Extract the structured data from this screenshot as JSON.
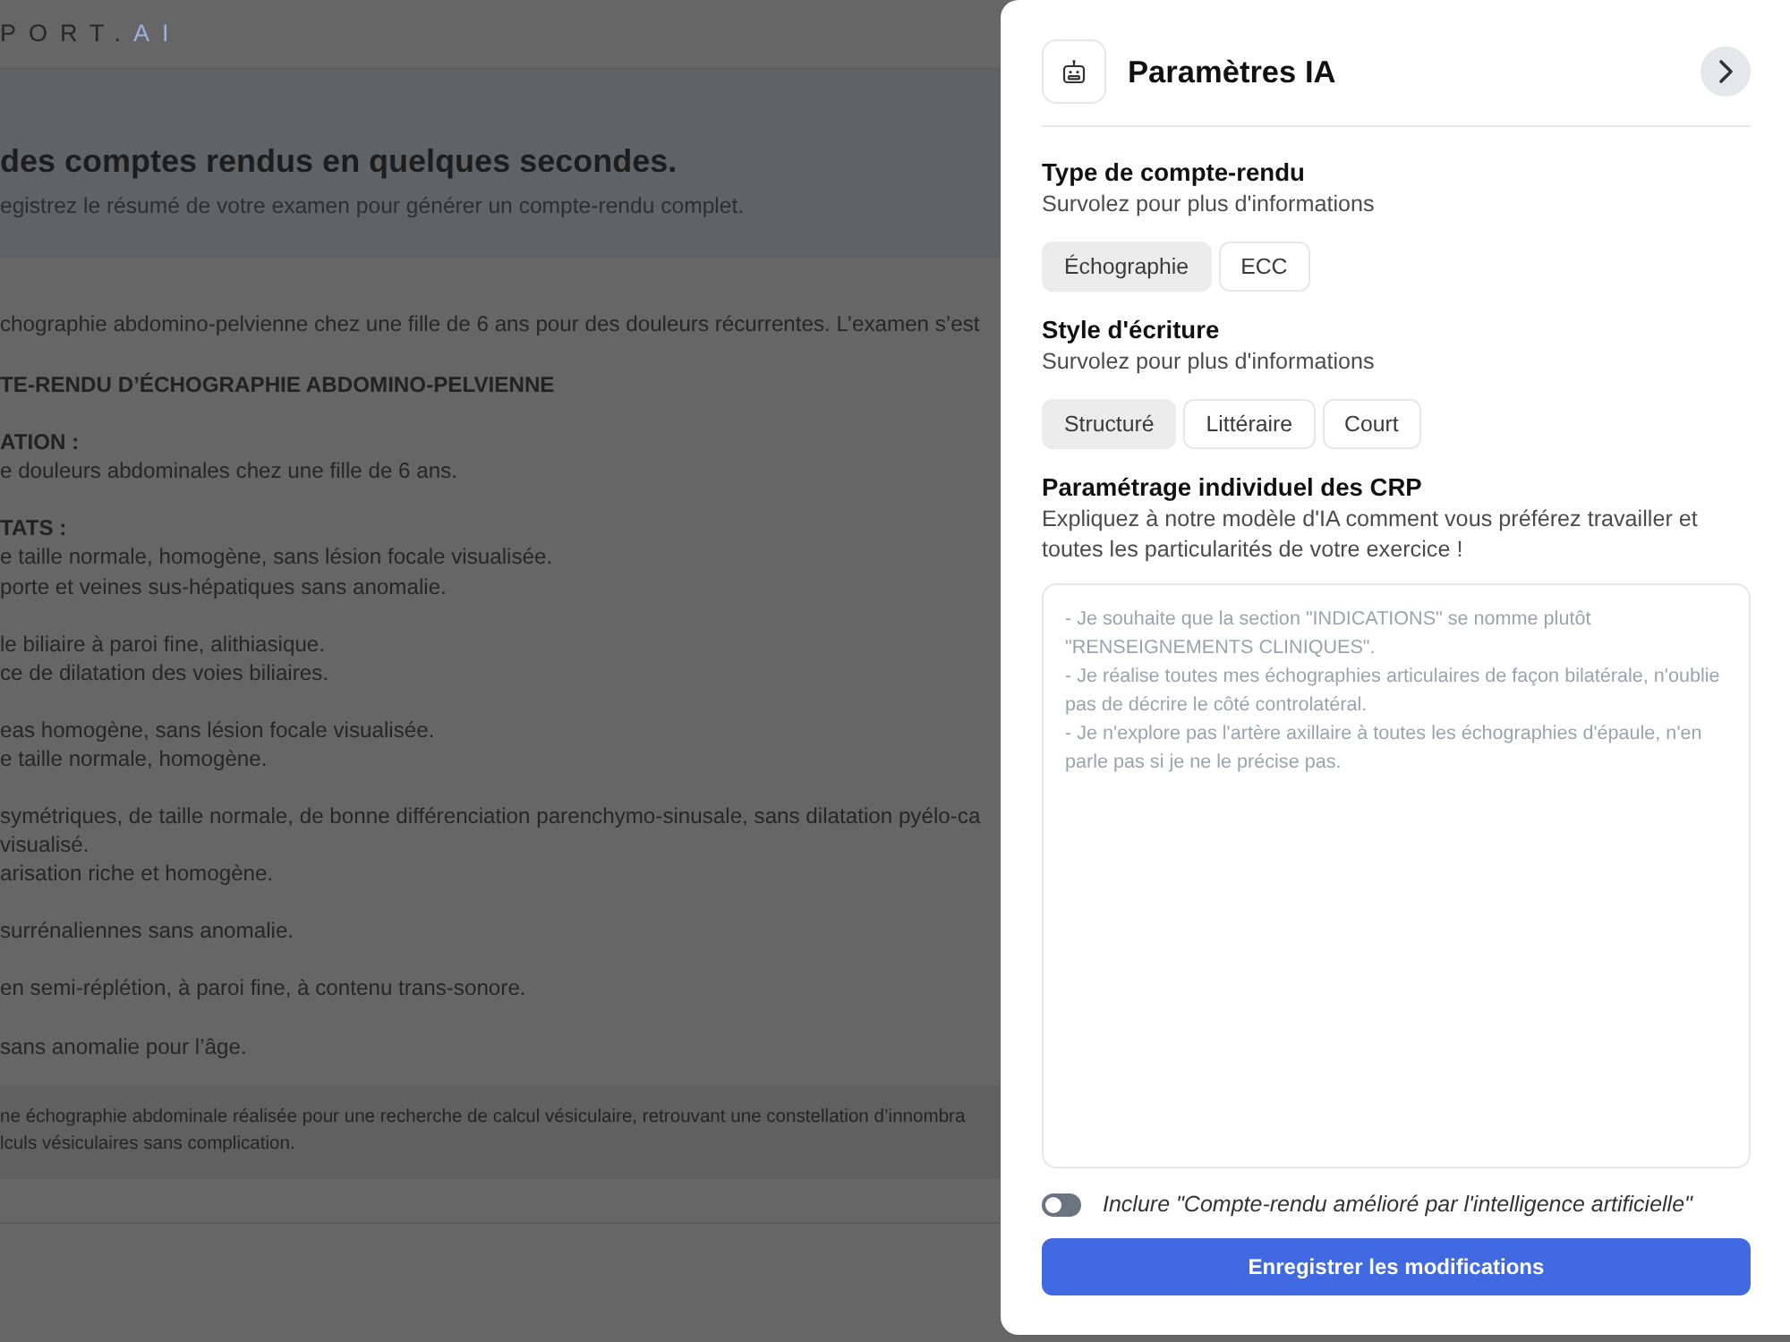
{
  "header": {
    "logo_main": "PORT.",
    "logo_accent": "AI"
  },
  "hero": {
    "title": "des comptes rendus en quelques secondes.",
    "subtitle": "egistrez le résumé de votre examen pour générer un compte-rendu complet."
  },
  "report": {
    "blocks": [
      [
        {
          "kind": "text",
          "text": "chographie abdomino-pelvienne chez une fille de 6 ans pour des douleurs récurrentes. L’examen s’est"
        }
      ],
      [
        {
          "kind": "heading",
          "text": "TE-RENDU D’ÉCHOGRAPHIE ABDOMINO-PELVIENNE"
        }
      ],
      [
        {
          "kind": "heading",
          "text": "ATION :"
        },
        {
          "kind": "text",
          "text": "e douleurs abdominales chez une fille de 6 ans."
        }
      ],
      [
        {
          "kind": "heading",
          "text": "TATS :"
        },
        {
          "kind": "text",
          "text": "e taille normale, homogène, sans lésion focale visualisée."
        },
        {
          "kind": "text",
          "text": "porte et veines sus-hépatiques sans anomalie."
        }
      ],
      [
        {
          "kind": "text",
          "text": "le biliaire à paroi fine, alithiasique."
        },
        {
          "kind": "text",
          "text": "ce de dilatation des voies biliaires."
        }
      ],
      [
        {
          "kind": "text",
          "text": "eas homogène, sans lésion focale visualisée."
        },
        {
          "kind": "text",
          "text": "e taille normale, homogène."
        }
      ],
      [
        {
          "kind": "text",
          "text": "symétriques, de taille normale, de bonne différenciation parenchymo-sinusale, sans dilatation pyélo-ca"
        },
        {
          "kind": "text",
          "text": "visualisé."
        },
        {
          "kind": "text",
          "text": "arisation riche et homogène."
        }
      ],
      [
        {
          "kind": "text",
          "text": "surrénaliennes sans anomalie."
        }
      ],
      [
        {
          "kind": "text",
          "text": "en semi-réplétion, à paroi fine, à contenu trans-sonore."
        }
      ],
      [
        {
          "kind": "text",
          "text": "sans anomalie pour l’âge."
        }
      ]
    ]
  },
  "note": {
    "lines": [
      "ne échographie abdominale réalisée pour une recherche de calcul vésiculaire, retrouvant une constellation d’innombra",
      "lculs vésiculaires sans complication."
    ]
  },
  "settings_panel": {
    "title": "Paramètres IA",
    "sections": [
      {
        "kind": "options",
        "title": "Type de compte-rendu",
        "hint": "Survolez pour plus d'informations",
        "options": [
          {
            "label": "Échographie",
            "selected": true
          },
          {
            "label": "ECC",
            "selected": false
          }
        ]
      },
      {
        "kind": "options",
        "title": "Style d'écriture",
        "hint": "Survolez pour plus d'informations",
        "options": [
          {
            "label": "Structuré",
            "selected": true
          },
          {
            "label": "Littéraire",
            "selected": false
          },
          {
            "label": "Court",
            "selected": false
          }
        ]
      },
      {
        "kind": "textarea",
        "title": "Paramétrage individuel des CRP",
        "hint": "Expliquez à notre modèle d'IA comment vous préférez travailler et toutes les particularités de votre exercice !",
        "placeholder": "- Je souhaite que la section \"INDICATIONS\" se nomme plutôt \"RENSEIGNEMENTS CLINIQUES\".\n- Je réalise toutes mes échographies articulaires de façon bilatérale, n'oublie pas de décrire le côté controlatéral.\n- Je n'explore pas l'artère axillaire à toutes les échographies d'épaule, n'en parle pas si je ne le précise pas."
      }
    ],
    "toggle": {
      "label": "Inclure \"Compte-rendu amélioré par l'intelligence artificielle\"",
      "on": false
    },
    "save_button": "Enregistrer les modifications"
  }
}
